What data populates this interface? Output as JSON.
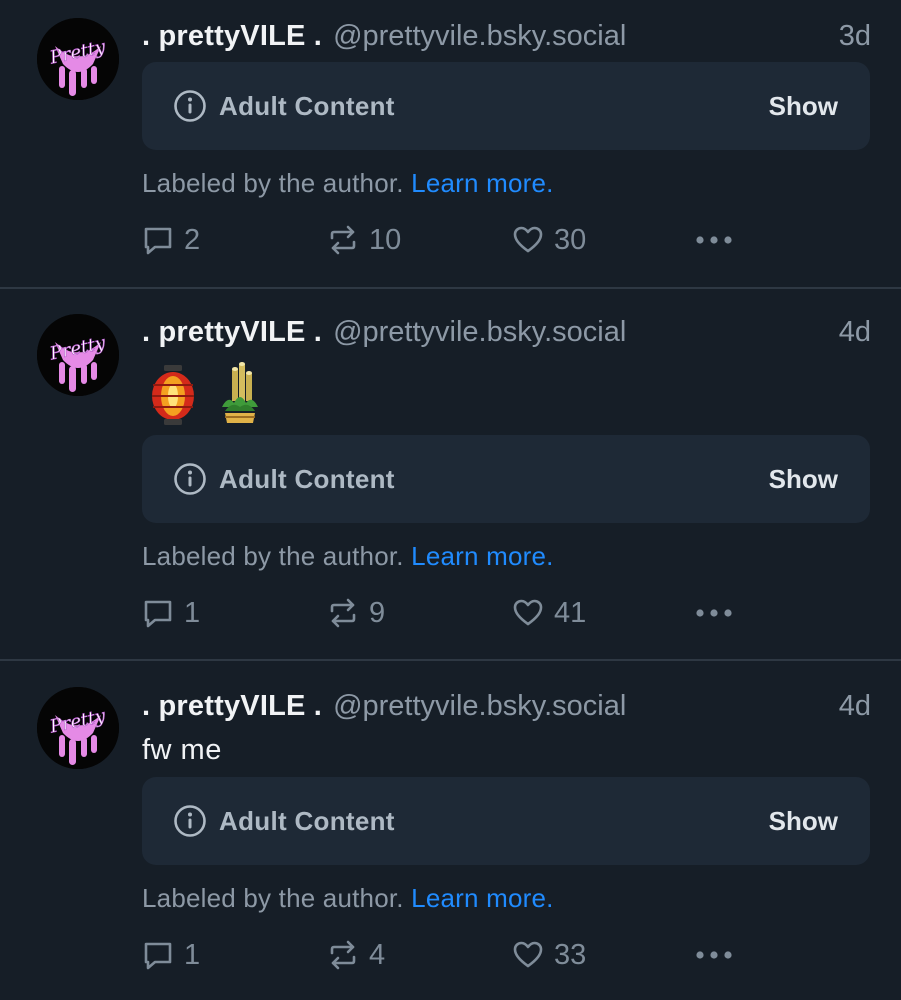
{
  "posts": [
    {
      "display_name": ". prettyVILE .",
      "handle": "@prettyvile.bsky.social",
      "time": "3d",
      "text": "",
      "emojis": [],
      "content_warning": {
        "label": "Adult Content",
        "show_label": "Show"
      },
      "label_notice": "Labeled by the author.",
      "learn_more": "Learn more.",
      "replies": "2",
      "reposts": "10",
      "likes": "30",
      "avatar_text": "Pretty"
    },
    {
      "display_name": ". prettyVILE .",
      "handle": "@prettyvile.bsky.social",
      "time": "4d",
      "text": "",
      "emojis": [
        "lantern-emoji",
        "kadomatsu-emoji"
      ],
      "content_warning": {
        "label": "Adult Content",
        "show_label": "Show"
      },
      "label_notice": "Labeled by the author.",
      "learn_more": "Learn more.",
      "replies": "1",
      "reposts": "9",
      "likes": "41",
      "avatar_text": "Pretty"
    },
    {
      "display_name": ". prettyVILE .",
      "handle": "@prettyvile.bsky.social",
      "time": "4d",
      "text": "fw me",
      "emojis": [],
      "content_warning": {
        "label": "Adult Content",
        "show_label": "Show"
      },
      "label_notice": "Labeled by the author.",
      "learn_more": "Learn more.",
      "replies": "1",
      "reposts": "4",
      "likes": "33",
      "avatar_text": "Pretty"
    }
  ],
  "colors": {
    "background": "#161e27",
    "card": "#1e2936",
    "link": "#208bfe",
    "muted": "#8d99a6",
    "avatar_accent": "#e58ae6"
  },
  "icons": {
    "info": "info-circle-icon",
    "reply": "speech-bubble-icon",
    "repost": "repost-arrows-icon",
    "like": "heart-icon",
    "more": "ellipsis-icon"
  }
}
